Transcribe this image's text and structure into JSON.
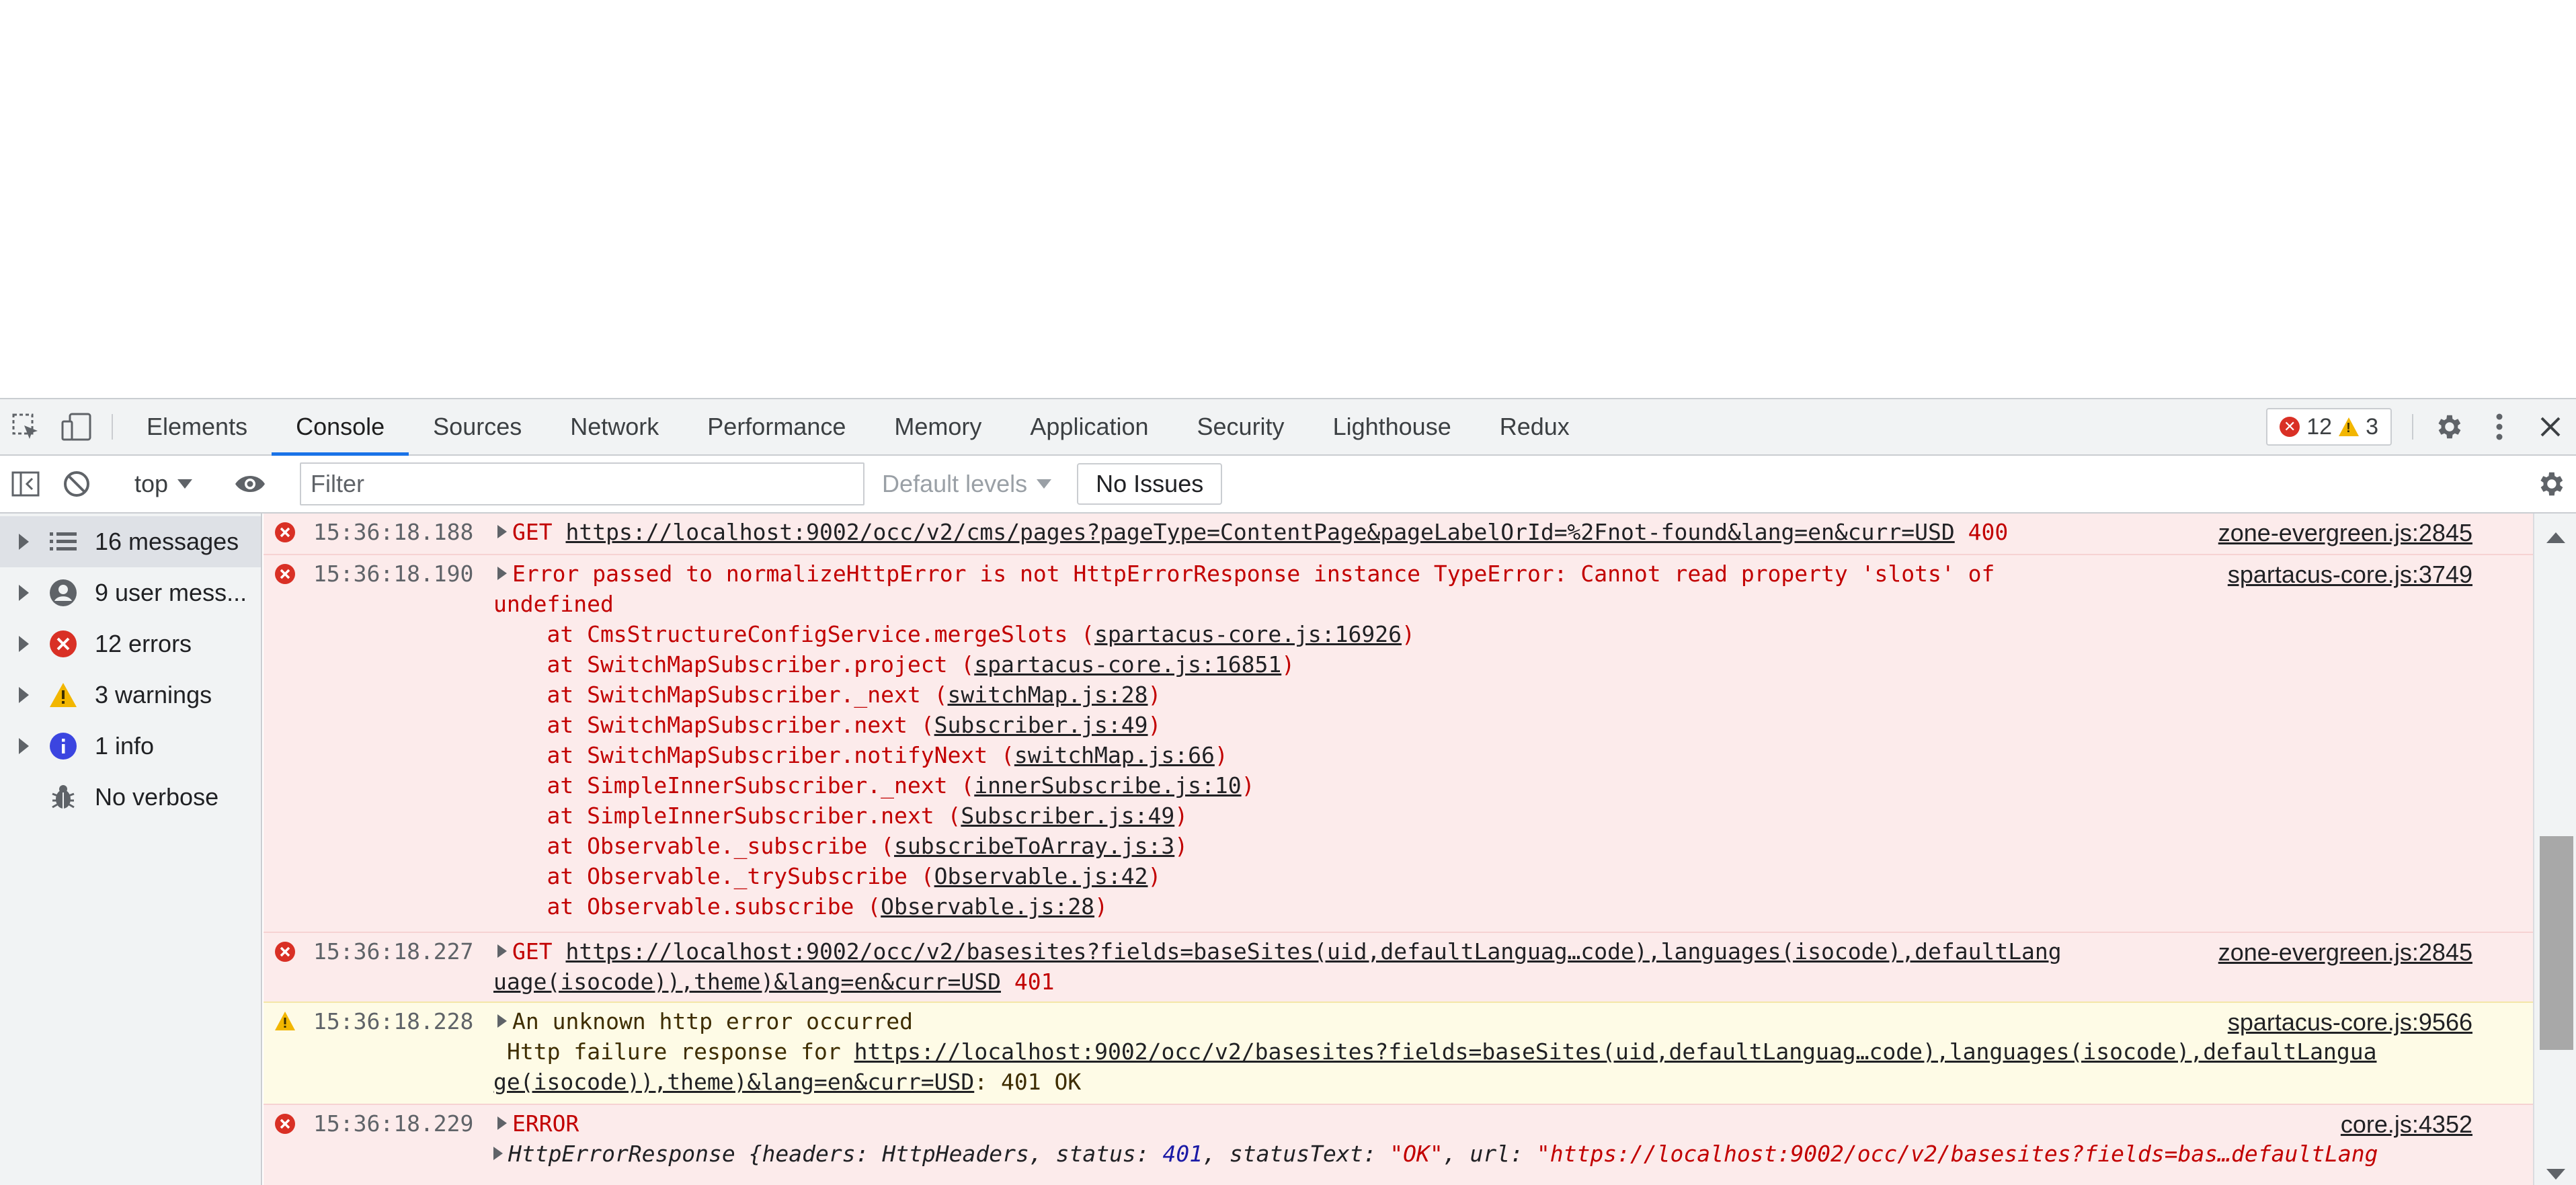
{
  "tabs": [
    {
      "label": "Elements"
    },
    {
      "label": "Console"
    },
    {
      "label": "Sources"
    },
    {
      "label": "Network"
    },
    {
      "label": "Performance"
    },
    {
      "label": "Memory"
    },
    {
      "label": "Application"
    },
    {
      "label": "Security"
    },
    {
      "label": "Lighthouse"
    },
    {
      "label": "Redux"
    }
  ],
  "issues_badge": {
    "errors": "12",
    "warnings": "3"
  },
  "toolbar": {
    "context": "top",
    "filter_placeholder": "Filter",
    "levels": "Default levels",
    "no_issues": "No Issues"
  },
  "sidebar": {
    "items": [
      {
        "label": "16 messages",
        "icon": "list-icon"
      },
      {
        "label": "9 user mess...",
        "icon": "user-icon"
      },
      {
        "label": "12 errors",
        "icon": "error-icon"
      },
      {
        "label": "3 warnings",
        "icon": "warning-icon"
      },
      {
        "label": "1 info",
        "icon": "info-icon"
      },
      {
        "label": "No verbose",
        "icon": "bug-icon"
      }
    ]
  },
  "messages": {
    "m1": {
      "time": "15:36:18.188",
      "method": "GET",
      "url": "https://localhost:9002/occ/v2/cms/pages?pageType=ContentPage&pageLabelOrId=%2Fnot-found&lang=en&curr=USD",
      "status": "400",
      "source": "zone-evergreen.js:2845"
    },
    "m2": {
      "time": "15:36:18.190",
      "text1": "Error passed to normalizeHttpError is not HttpErrorResponse instance TypeError: Cannot read property 'slots' of",
      "text2": "undefined",
      "source": "spartacus-core.js:3749",
      "stack": [
        {
          "pre": "    at CmsStructureConfigService.mergeSlots (",
          "link": "spartacus-core.js:16926",
          "post": ")"
        },
        {
          "pre": "    at SwitchMapSubscriber.project (",
          "link": "spartacus-core.js:16851",
          "post": ")"
        },
        {
          "pre": "    at SwitchMapSubscriber._next (",
          "link": "switchMap.js:28",
          "post": ")"
        },
        {
          "pre": "    at SwitchMapSubscriber.next (",
          "link": "Subscriber.js:49",
          "post": ")"
        },
        {
          "pre": "    at SwitchMapSubscriber.notifyNext (",
          "link": "switchMap.js:66",
          "post": ")"
        },
        {
          "pre": "    at SimpleInnerSubscriber._next (",
          "link": "innerSubscribe.js:10",
          "post": ")"
        },
        {
          "pre": "    at SimpleInnerSubscriber.next (",
          "link": "Subscriber.js:49",
          "post": ")"
        },
        {
          "pre": "    at Observable._subscribe (",
          "link": "subscribeToArray.js:3",
          "post": ")"
        },
        {
          "pre": "    at Observable._trySubscribe (",
          "link": "Observable.js:42",
          "post": ")"
        },
        {
          "pre": "    at Observable.subscribe (",
          "link": "Observable.js:28",
          "post": ")"
        }
      ]
    },
    "m3": {
      "time": "15:36:18.227",
      "method": "GET",
      "url1": "https://localhost:9002/occ/v2/basesites?fields=baseSites(uid,defaultLanguag…code),languages(isocode),defaultLang",
      "url2": "uage(isocode)),theme)&lang=en&curr=USD",
      "status": "401",
      "source": "zone-evergreen.js:2845"
    },
    "m4": {
      "time": "15:36:18.228",
      "text": "An unknown http error occurred",
      "prefix": "Http failure response for ",
      "url1": "https://localhost:9002/occ/v2/basesites?fields=baseSites(uid,defaultLanguag…code),languages(isocode),defaultLangua",
      "url2": "ge(isocode)),theme)&lang=en&curr=USD",
      "suffix": ": 401 OK",
      "source": "spartacus-core.js:9566"
    },
    "m5": {
      "time": "15:36:18.229",
      "text": "ERROR",
      "source": "core.js:4352",
      "obj_name": "HttpErrorResponse ",
      "obj_open": "{",
      "k_headers": "headers: ",
      "v_headers": "HttpHeaders",
      "k_status": ", status: ",
      "v_status": "401",
      "k_statusText": ", statusText: ",
      "v_statusText": "\"OK\"",
      "k_url": ", url: ",
      "v_url": "\"https://localhost:9002/occ/v2/basesites?fields=bas…defaultLang"
    }
  }
}
